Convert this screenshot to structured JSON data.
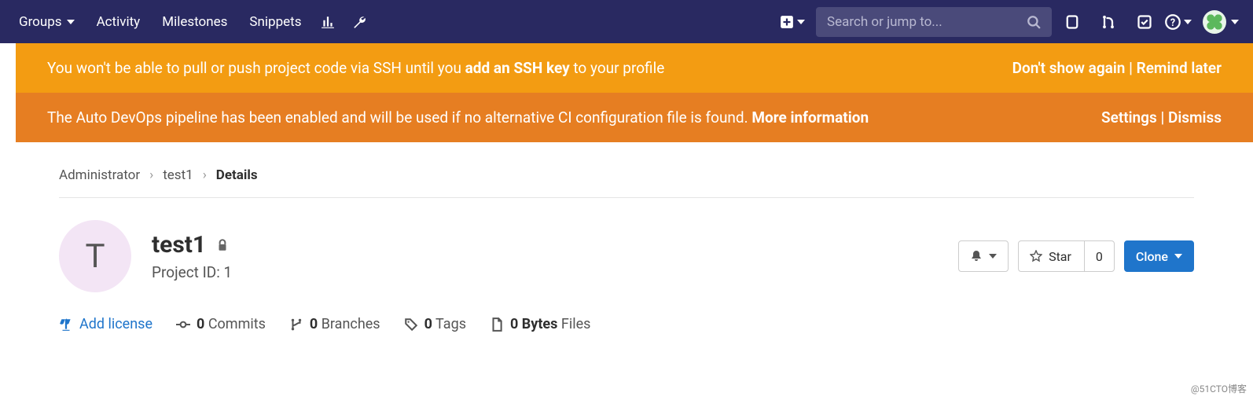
{
  "topnav": {
    "items": [
      "Groups",
      "Activity",
      "Milestones",
      "Snippets"
    ],
    "search_placeholder": "Search or jump to..."
  },
  "banners": {
    "ssh": {
      "pre": "You won't be able to pull or push project code via SSH until you ",
      "link": "add an SSH key",
      "post": " to your profile",
      "action1": "Don't show again",
      "action2": "Remind later"
    },
    "devops": {
      "msg": "The Auto DevOps pipeline has been enabled and will be used if no alternative CI configuration file is found. ",
      "link": "More information",
      "action1": "Settings",
      "action2": "Dismiss"
    }
  },
  "breadcrumb": {
    "owner": "Administrator",
    "project": "test1",
    "current": "Details"
  },
  "project": {
    "avatar_letter": "T",
    "name": "test1",
    "id_label": "Project ID: 1",
    "star_label": "Star",
    "star_count": "0",
    "clone_label": "Clone"
  },
  "stats": {
    "license": "Add license",
    "commits_count": "0",
    "commits_label": "Commits",
    "branches_count": "0",
    "branches_label": "Branches",
    "tags_count": "0",
    "tags_label": "Tags",
    "size_count": "0 Bytes",
    "size_label": "Files"
  },
  "watermark": "@51CTO博客"
}
